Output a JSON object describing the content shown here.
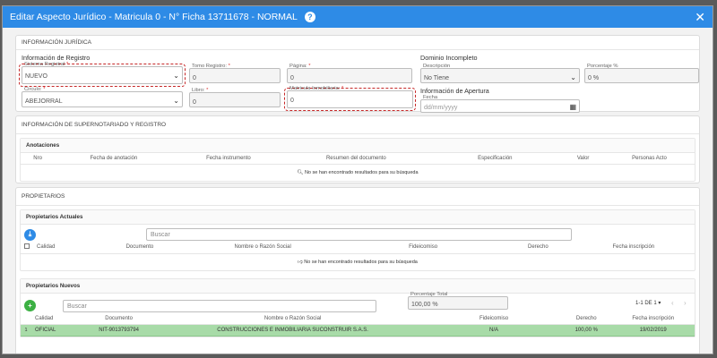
{
  "dialog": {
    "title": "Editar Aspecto Jurídico - Matricula 0 - N° Ficha 13711678 - NORMAL",
    "help_icon": "question-circle-icon",
    "close_icon": "close-icon"
  },
  "juridica": {
    "panel_title": "INFORMACIÓN JURÍDICA",
    "registro_title": "Información de Registro",
    "sistema_registral": {
      "label": "Sistema Registral",
      "value": "NUEVO"
    },
    "tomo_registro": {
      "label": "Tomo Registro:",
      "value": "0"
    },
    "pagina": {
      "label": "Página:",
      "value": "0"
    },
    "circulo": {
      "label": "Circulo:",
      "value": "ABEJORRAL"
    },
    "libro": {
      "label": "Libro:",
      "value": "0"
    },
    "matricula_inmobiliaria": {
      "label": "Matricula Inmobiliaria:",
      "value": "0"
    },
    "dominio_title": "Dominio Incompleto",
    "descripcion": {
      "label": "Descripción",
      "value": "No Tiene"
    },
    "porcentaje": {
      "label": "Porcentaje %",
      "value": "0 %"
    },
    "apertura_title": "Información de Apertura",
    "fecha": {
      "label": "Fecha",
      "placeholder": "dd/mm/yyyy"
    }
  },
  "supernotariado": {
    "panel_title": "INFORMACIÓN DE SUPERNOTARIADO Y REGISTRO",
    "anotaciones_title": "Anotaciones",
    "columns": [
      "Nro",
      "Fecha de anotación",
      "Fecha instrumento",
      "Resumen del documento",
      "Especificación",
      "Valor",
      "Personas Acto"
    ],
    "empty_text": "No se han encontrado resultados para su búsqueda"
  },
  "propietarios": {
    "panel_title": "PROPIETARIOS",
    "actuales": {
      "title": "Propietarios Actuales",
      "search_placeholder": "Buscar",
      "columns": [
        "Calidad",
        "Documento",
        "Nombre o Razón Social",
        "Fideicomiso",
        "Derecho",
        "Fecha inscripción"
      ],
      "empty_text": "No se han encontrado resultados para su búsqueda"
    },
    "nuevos": {
      "title": "Propietarios Nuevos",
      "search_placeholder": "Buscar",
      "porcentaje_total": {
        "label": "Porcentaje Total",
        "value": "100,00 %"
      },
      "pager": "1-1 DE 1",
      "columns": [
        "Calidad",
        "Documento",
        "Nombre o Razón Social",
        "Fideicomiso",
        "Derecho",
        "Fecha inscripción"
      ],
      "rows": [
        {
          "num": "1",
          "calidad": "OFICIAL",
          "documento": "NIT-9013793794",
          "nombre": "CONSTRUCCIONES E INMOBILIARIA SUCONSTRUIR S.A.S.",
          "fideicomiso": "N/A",
          "derecho": "100,00 %",
          "fecha": "19/02/2019"
        }
      ]
    }
  },
  "colors": {
    "titlebar": "#2e8be6",
    "highlight": "#c62828",
    "row_selected": "#a8dba8",
    "add_button": "#3cb043",
    "download_button": "#2e8be6"
  }
}
